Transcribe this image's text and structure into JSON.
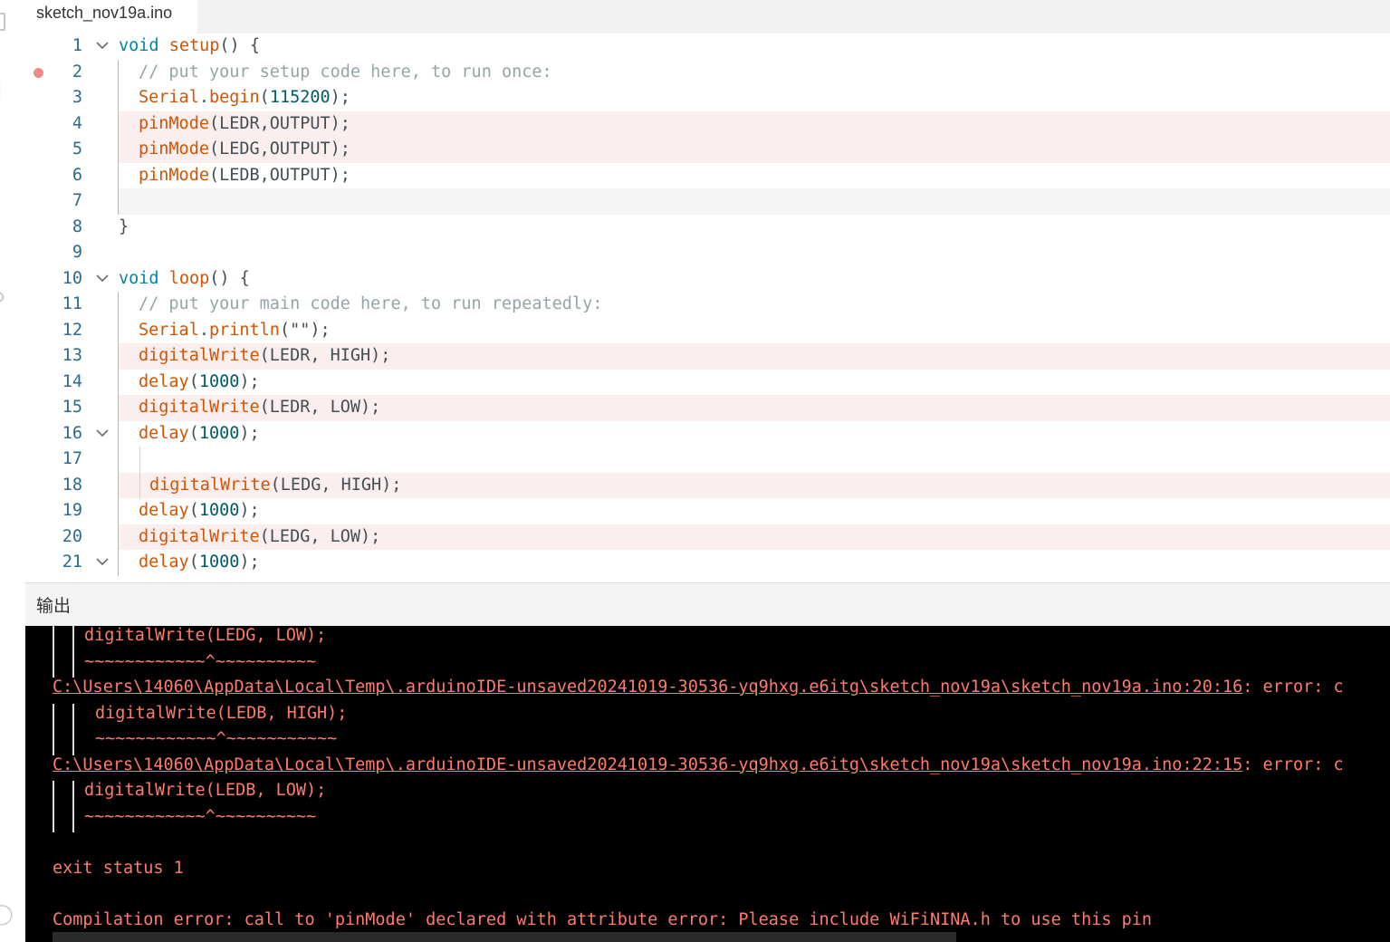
{
  "tab": {
    "label": "sketch_nov19a.ino"
  },
  "editor": {
    "lines": [
      {
        "num": "1",
        "fold": true,
        "indent": 0,
        "tokens": [
          [
            "kw",
            "void "
          ],
          [
            "fn",
            "setup"
          ],
          [
            "pl",
            "() {"
          ]
        ]
      },
      {
        "num": "2",
        "fold": false,
        "breakpoint": true,
        "indent": 1,
        "tokens": [
          [
            "cm",
            "// put your setup code here, to run once:"
          ]
        ]
      },
      {
        "num": "3",
        "fold": false,
        "indent": 1,
        "tokens": [
          [
            "fn",
            "Serial"
          ],
          [
            "pl",
            "."
          ],
          [
            "fn",
            "begin"
          ],
          [
            "pl",
            "("
          ],
          [
            "num",
            "115200"
          ],
          [
            "pl",
            ");"
          ]
        ]
      },
      {
        "num": "4",
        "fold": false,
        "hl": true,
        "indent": 1,
        "tokens": [
          [
            "fn",
            "pinMode"
          ],
          [
            "pl",
            "(LEDR,OUTPUT);"
          ]
        ]
      },
      {
        "num": "5",
        "fold": false,
        "hl": true,
        "indent": 1,
        "tokens": [
          [
            "fn",
            "pinMode"
          ],
          [
            "pl",
            "(LEDG,OUTPUT);"
          ]
        ]
      },
      {
        "num": "6",
        "fold": false,
        "indent": 1,
        "tokens": [
          [
            "fn",
            "pinMode"
          ],
          [
            "pl",
            "(LEDB,OUTPUT);"
          ]
        ]
      },
      {
        "num": "7",
        "fold": false,
        "cur": true,
        "indent": 1,
        "tokens": []
      },
      {
        "num": "8",
        "fold": false,
        "indent": 0,
        "tokens": [
          [
            "pl",
            "}"
          ]
        ]
      },
      {
        "num": "9",
        "fold": false,
        "indent": 0,
        "tokens": []
      },
      {
        "num": "10",
        "fold": true,
        "indent": 0,
        "tokens": [
          [
            "kw",
            "void "
          ],
          [
            "fn",
            "loop"
          ],
          [
            "pl",
            "() {"
          ]
        ]
      },
      {
        "num": "11",
        "fold": false,
        "indent": 1,
        "tokens": [
          [
            "cm",
            "// put your main code here, to run repeatedly:"
          ]
        ]
      },
      {
        "num": "12",
        "fold": false,
        "indent": 1,
        "tokens": [
          [
            "fn",
            "Serial"
          ],
          [
            "pl",
            "."
          ],
          [
            "fn",
            "println"
          ],
          [
            "pl",
            "(\"\");"
          ]
        ]
      },
      {
        "num": "13",
        "fold": false,
        "hl": true,
        "indent": 1,
        "tokens": [
          [
            "fn",
            "digitalWrite"
          ],
          [
            "pl",
            "(LEDR, HIGH);"
          ]
        ]
      },
      {
        "num": "14",
        "fold": false,
        "indent": 1,
        "tokens": [
          [
            "fn",
            "delay"
          ],
          [
            "pl",
            "("
          ],
          [
            "num",
            "1000"
          ],
          [
            "pl",
            ");"
          ]
        ]
      },
      {
        "num": "15",
        "fold": false,
        "hl": true,
        "indent": 1,
        "tokens": [
          [
            "fn",
            "digitalWrite"
          ],
          [
            "pl",
            "(LEDR, LOW);"
          ]
        ]
      },
      {
        "num": "16",
        "fold": true,
        "indent": 1,
        "tokens": [
          [
            "fn",
            "delay"
          ],
          [
            "pl",
            "("
          ],
          [
            "num",
            "1000"
          ],
          [
            "pl",
            ");"
          ]
        ]
      },
      {
        "num": "17",
        "fold": false,
        "indent": 2,
        "tokens": []
      },
      {
        "num": "18",
        "fold": false,
        "hl": true,
        "indent": 2,
        "tokens": [
          [
            "fn",
            "digitalWrite"
          ],
          [
            "pl",
            "(LEDG, HIGH);"
          ]
        ]
      },
      {
        "num": "19",
        "fold": false,
        "indent": 1,
        "tokens": [
          [
            "fn",
            "delay"
          ],
          [
            "pl",
            "("
          ],
          [
            "num",
            "1000"
          ],
          [
            "pl",
            ");"
          ]
        ]
      },
      {
        "num": "20",
        "fold": false,
        "hl": true,
        "indent": 1,
        "tokens": [
          [
            "fn",
            "digitalWrite"
          ],
          [
            "pl",
            "(LEDG, LOW);"
          ]
        ]
      },
      {
        "num": "21",
        "fold": true,
        "indent": 1,
        "tokens": [
          [
            "fn",
            "delay"
          ],
          [
            "pl",
            "("
          ],
          [
            "num",
            "1000"
          ],
          [
            "pl",
            ");"
          ]
        ]
      }
    ]
  },
  "output": {
    "title": "输出",
    "lines": [
      {
        "text": "digitalWrite(LEDG, LOW);",
        "bars": 2,
        "indent": 35
      },
      {
        "text": "~~~~~~~~~~~~^~~~~~~~~~~",
        "bars": 2,
        "indent": 35
      },
      {
        "text": "C:\\Users\\14060\\AppData\\Local\\Temp\\.arduinoIDE-unsaved20241019-30536-yq9hxg.e6itg\\sketch_nov19a\\sketch_nov19a.ino:20:16: error: c",
        "link": "C:\\Users\\14060\\AppData\\Local\\Temp\\.arduinoIDE-unsaved20241019-30536-yq9hxg.e6itg\\sketch_nov19a\\sketch_nov19a.ino:20:16",
        "bars": 0,
        "indent": 0
      },
      {
        "text": "digitalWrite(LEDB, HIGH);",
        "bars": 2,
        "indent": 47
      },
      {
        "text": "~~~~~~~~~~~~^~~~~~~~~~~~",
        "bars": 2,
        "indent": 47
      },
      {
        "text": "C:\\Users\\14060\\AppData\\Local\\Temp\\.arduinoIDE-unsaved20241019-30536-yq9hxg.e6itg\\sketch_nov19a\\sketch_nov19a.ino:22:15: error: c",
        "link": "C:\\Users\\14060\\AppData\\Local\\Temp\\.arduinoIDE-unsaved20241019-30536-yq9hxg.e6itg\\sketch_nov19a\\sketch_nov19a.ino:22:15",
        "bars": 0,
        "indent": 0
      },
      {
        "text": "digitalWrite(LEDB, LOW);",
        "bars": 2,
        "indent": 35
      },
      {
        "text": "~~~~~~~~~~~~^~~~~~~~~~~",
        "bars": 2,
        "indent": 35
      },
      {
        "text": "",
        "bars": 0,
        "indent": 0
      },
      {
        "text": "exit status 1",
        "bars": 0,
        "indent": 0
      },
      {
        "text": "",
        "bars": 0,
        "indent": 0
      },
      {
        "text": "Compilation error: call to 'pinMode' declared with attribute error: Please include WiFiNINA.h to use this pin",
        "bars": 0,
        "indent": 0
      }
    ]
  },
  "colors": {
    "error": "#ff7b6b",
    "line_highlight": "#fbeeee",
    "line_number": "#2e6a8a",
    "keyword": "#00879a",
    "function": "#d35400",
    "comment": "#95a5a6",
    "number": "#005c5f"
  },
  "icons": {
    "fold": "chevron-down-icon",
    "breakpoint": "breakpoint-dot-icon"
  }
}
